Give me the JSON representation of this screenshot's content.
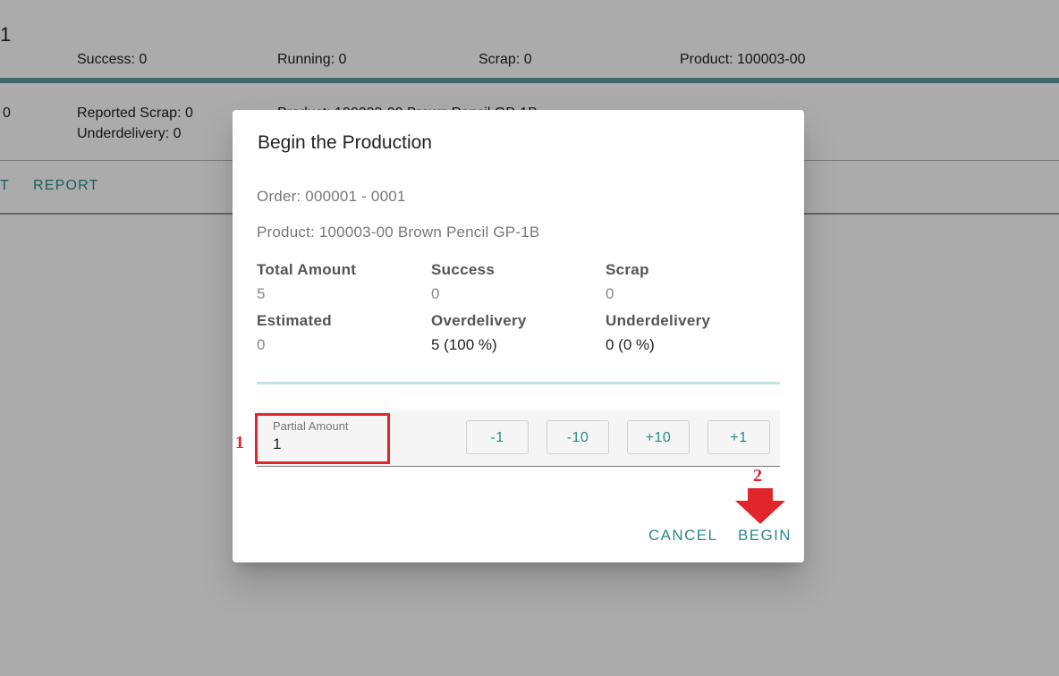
{
  "background": {
    "title_fragment": "1",
    "stats": [
      "Success: 0",
      "Running: 0",
      "Scrap: 0",
      "Product: 100003-00"
    ],
    "row_left_value": "0",
    "reported_scrap": "Reported Scrap: 0",
    "underdelivery": "Underdelivery: 0",
    "product_partial": "Product: 100003-00 Brown Pencil GP-1B",
    "action_fragment": "T",
    "action_report": "REPORT"
  },
  "dialog": {
    "title": "Begin the Production",
    "order": "Order: 000001 - 0001",
    "product": "Product: 100003-00 Brown Pencil GP-1B",
    "stats": [
      {
        "label": "Total Amount",
        "value": "5"
      },
      {
        "label": "Success",
        "value": "0"
      },
      {
        "label": "Scrap",
        "value": "0"
      },
      {
        "label": "Estimated",
        "value": "0"
      },
      {
        "label": "Overdelivery",
        "value": "5 (100 %)"
      },
      {
        "label": "Underdelivery",
        "value": "0 (0 %)"
      }
    ],
    "partial_amount": {
      "label": "Partial Amount",
      "value": "1"
    },
    "step_buttons": [
      "-1",
      "-10",
      "+10",
      "+1"
    ],
    "cancel_label": "CANCEL",
    "begin_label": "BEGIN"
  },
  "annotations": {
    "marker_1": "1",
    "marker_2": "2",
    "color": "#e0262b"
  },
  "colors": {
    "accent": "#2b8a8a",
    "separator": "#c4e2e2",
    "overlay": "rgba(0,0,0,0.33)"
  }
}
